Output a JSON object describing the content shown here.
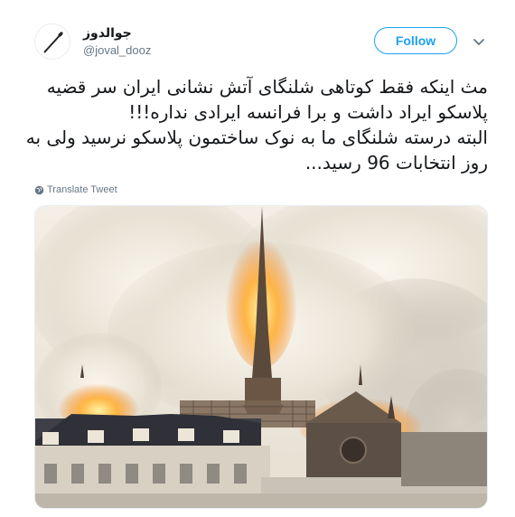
{
  "user": {
    "display_name": "جوالدوز",
    "handle": "@joval_dooz"
  },
  "actions": {
    "follow_label": "Follow"
  },
  "tweet": {
    "lines": [
      "مث اینکه فقط کوتاهی شلنگای آتش نشانی ایران سر قضیه",
      "پلاسکو ایراد داشت و برا فرانسه ایرادی نداره!!!",
      "البته درسته شلنگای ما به نوک ساختمون پلاسکو نرسید ولی به",
      "روز انتخابات 96 رسید..."
    ],
    "translate_label": "Translate Tweet"
  },
  "icons": {
    "avatar": "needle-avatar-icon",
    "caret": "chevron-down-icon",
    "globe": "globe-icon"
  },
  "colors": {
    "accent": "#1da1f2",
    "secondary_text": "#657786",
    "primary_text": "#14171a"
  },
  "media": {
    "subject": "burning-cathedral-photo"
  }
}
